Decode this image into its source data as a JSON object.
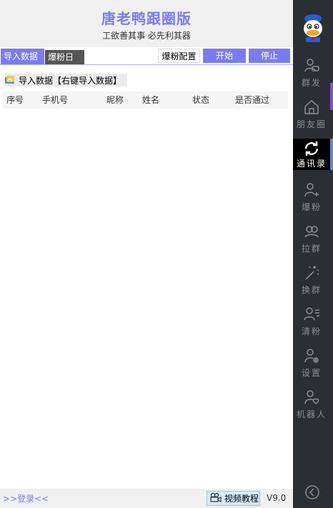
{
  "header": {
    "title": "唐老鸭跟圈版",
    "slogan": "工欲善其事 必先利其器"
  },
  "tabs": [
    {
      "label": "导入数据"
    },
    {
      "label": "爆粉日志"
    }
  ],
  "toolbar": {
    "config_label": "爆粉配置",
    "start_label": "开始",
    "stop_label": "停止"
  },
  "import_hint": "导入数据【右键导入数据】",
  "table": {
    "columns": [
      "序号",
      "手机号",
      "昵称",
      "姓名",
      "状态",
      "是否通过"
    ],
    "rows": []
  },
  "footer": {
    "login_label": ">>登录<<",
    "video_label": "视频教程",
    "version": "V9.0"
  },
  "sidebar": {
    "items": [
      {
        "label": "群发",
        "icon": "user-chat-icon"
      },
      {
        "label": "朋友圈",
        "icon": "home-icon"
      },
      {
        "label": "通讯录",
        "icon": "refresh-icon"
      },
      {
        "label": "爆粉",
        "icon": "user-add-icon"
      },
      {
        "label": "拉群",
        "icon": "group-icon"
      },
      {
        "label": "换群",
        "icon": "magic-wand-icon"
      },
      {
        "label": "清粉",
        "icon": "user-list-icon"
      },
      {
        "label": "设置",
        "icon": "user-settings-icon"
      },
      {
        "label": "机器人",
        "icon": "user-heart-icon"
      }
    ],
    "active_index": 2
  },
  "colors": {
    "accent": "#7b7bf0",
    "sidebar_bg": "#2b2f33",
    "sidebar_active": "#000000",
    "sidebar_text": "#8a8f94"
  }
}
